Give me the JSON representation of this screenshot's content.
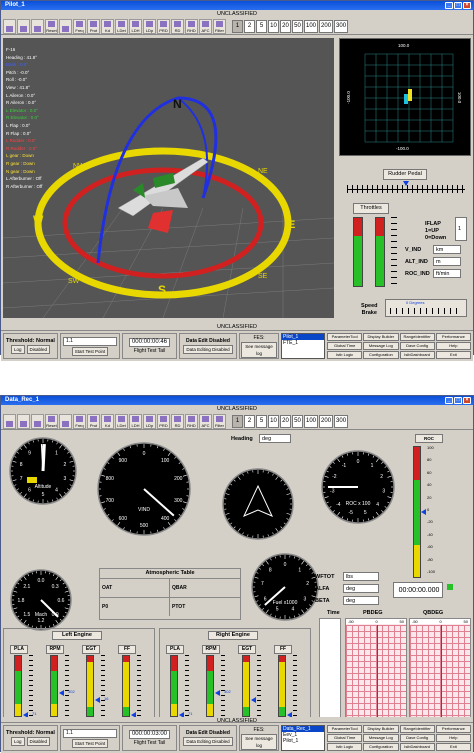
{
  "banner": "UNCLASSIFIED",
  "toolbar": {
    "tools": [
      "",
      "",
      "",
      "Reset",
      "",
      "Freq",
      "Prot",
      "Kd",
      "LDet",
      "LDH",
      "LDp",
      "PRD",
      "RD",
      "RHD",
      "AFC",
      "Filter"
    ],
    "zoom": [
      "1",
      "2",
      "5",
      "10",
      "20",
      "50",
      "100",
      "200",
      "300"
    ],
    "zoom_selected": "1"
  },
  "window1": {
    "title": "Pilot_1",
    "telemetry": [
      "F-16",
      "Heading : 41.8°",
      "Bank : 0.0°",
      "Pitch : -0.0°",
      "Roll : -0.0°",
      "View : 41.8°",
      "L Aileron : 0.0°",
      "R Aileron : 0.0°",
      "L Elevator : 0.0°",
      "R Elevator : 0.0°",
      "L Flap : 0.0°",
      "R Flap : 0.0°",
      "L Rudder : 0.0°",
      "R Rudder : 0.0°",
      "L gear : Down",
      "R gear : Down",
      "N gear : Down",
      "L Afterburner : Off",
      "R Afterburner : Off"
    ],
    "compass": [
      "N",
      "S",
      "E",
      "W",
      "NE",
      "SE",
      "SW",
      "NW"
    ],
    "radar_ticks": {
      "top": "100.0",
      "bottom": "-100.0",
      "left": "-100.0",
      "right": "100.0"
    },
    "rudder_label": "Rudder Pedal",
    "throttles_label": "Throttles",
    "flap_info": [
      "IFLAP",
      "1=UP",
      "0=Down"
    ],
    "flap_value": "1",
    "v_ind": {
      "label": "V_IND",
      "unit": "km"
    },
    "alt_ind": {
      "label": "ALT_IND",
      "unit": "m"
    },
    "roc_ind": {
      "label": "ROC_IND",
      "unit": "ft/min"
    },
    "speed_brake": [
      "Speed",
      "Brake"
    ],
    "speed_brake_unit": "0 Degrees",
    "throttle_levels": [
      0.73,
      0.73
    ],
    "rudder_position": 0.5
  },
  "window2": {
    "title": "Data_Rec_1",
    "heading": {
      "label": "Heading",
      "unit": "deg"
    },
    "roc_label": "ROC",
    "altitude_label": "Altitude",
    "vind_label": "VIND",
    "vind_value": "1.0",
    "roc_gauge_label": "ROC x 100",
    "mach_label": "Mach",
    "fuel_label": "Fuel x1000",
    "atmospheric": {
      "title": "Atmospheric Table",
      "rows": [
        [
          "OAT",
          "QBAR"
        ],
        [
          "P0",
          "PTOT"
        ]
      ]
    },
    "wftot": {
      "label": "WFTOT",
      "unit": "lbs"
    },
    "alfa": {
      "label": "ALFA",
      "unit": "deg"
    },
    "beta": {
      "label": "BETA",
      "unit": "deg"
    },
    "clock": "00:00:00.000",
    "time_label": "Time",
    "pbdeg": {
      "label": "PBDEG",
      "ticks": [
        "-50",
        "0",
        "50"
      ]
    },
    "qbdeg": {
      "label": "QBDEG",
      "ticks": [
        "-50",
        "0",
        "50"
      ]
    },
    "left_engine": "Left Engine",
    "right_engine": "Right Engine",
    "engine_gauges": [
      "PLA",
      "RPM",
      "EGT",
      "FF"
    ],
    "left_markers": [
      "71",
      "302",
      "16"
    ],
    "right_markers": [
      "71",
      "302"
    ],
    "roc_bar_level": 0.5,
    "engine_bar_levels": [
      0.05,
      0.42,
      0.3,
      0.05
    ],
    "roc_ticks": [
      "100",
      "80",
      "60",
      "40",
      "20",
      "0",
      "-20",
      "-40",
      "-60",
      "-80",
      "-100"
    ],
    "alt_numbers": [
      "0",
      "1",
      "2",
      "3",
      "4",
      "5",
      "6",
      "7",
      "8",
      "9"
    ],
    "vind_numbers": [
      "0",
      "100",
      "200",
      "300",
      "400",
      "500",
      "600",
      "700",
      "800",
      "900"
    ],
    "roc_numbers": [
      "0",
      "1",
      "2",
      "3",
      "4",
      "5",
      "-5",
      "-4",
      "-3",
      "-2",
      "-1"
    ],
    "mach_numbers": [
      "0.0",
      "0.3",
      "0.6",
      "0.9",
      "1.2",
      "1.5",
      "1.8",
      "2.1"
    ],
    "fuel_numbers": [
      "0",
      "1",
      "2",
      "3",
      "4",
      "5",
      "6",
      "7",
      "8"
    ]
  },
  "status1": {
    "threshold": "Threshold: Normal",
    "log": "Log",
    "disabled": "Disabled",
    "test_value": "1.1",
    "start_test": "Start Test Point",
    "time": "000:00:00:46",
    "tail": "Flight Test Tail",
    "data_edit": "Data Edit Disabled",
    "data_editing": "Data Editing Disabled",
    "fes": "FES:",
    "see_msg": "See message log",
    "list": [
      "Pilot_1",
      "FTE_1"
    ],
    "list_selected": "Pilot_1"
  },
  "status2": {
    "threshold": "Threshold: Normal",
    "log": "Log",
    "disabled": "Disabled",
    "test_value": "1.1",
    "start_test": "Start Test Point",
    "time": "000:00:03:00",
    "tail": "Flight Test Tail",
    "data_edit": "Data Edit Disabled",
    "data_editing": "Data Editing Disabled",
    "fes": "FES:",
    "see_msg": "See message log",
    "list": [
      "Data_Rec_1",
      "Eev_1",
      "Pilot_1"
    ],
    "list_selected": "Data_Rec_1"
  },
  "grid_buttons": [
    "ParameterTool",
    "Display Builder",
    "RangeIdentifier",
    "Performance",
    "Global Time",
    "Message Log",
    "Dave Config",
    "Help",
    "Istb Logic",
    "Configuration",
    "IsibDashboard",
    "Exit"
  ]
}
